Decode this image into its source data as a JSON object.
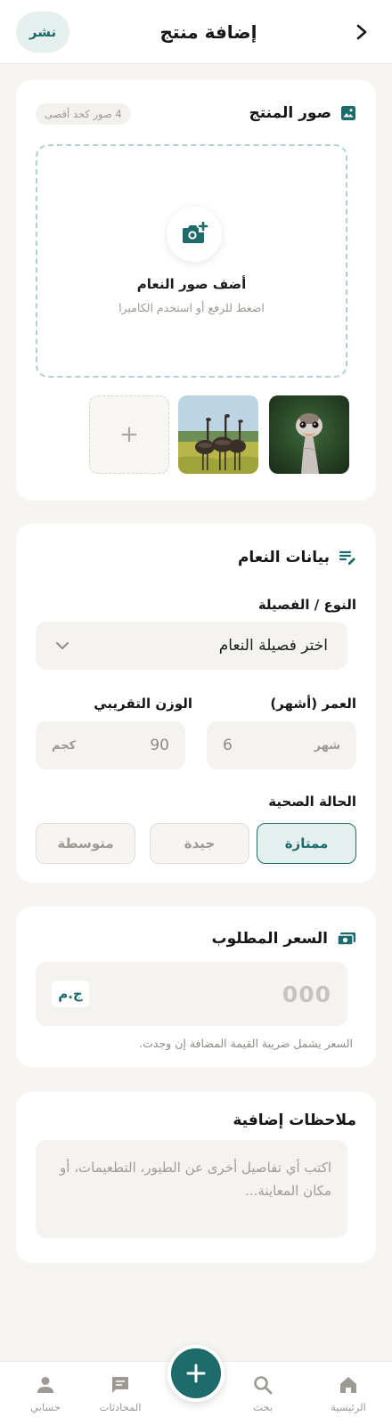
{
  "header": {
    "title": "إضافة منتج",
    "publish_label": "نشر"
  },
  "photos": {
    "title": "صور المنتج",
    "limit_badge": "4 صور كحد أقصى",
    "upload_title": "أضف صور النعام",
    "upload_subtitle": "اضغط للرفع أو استخدم الكاميرا",
    "add_more_symbol": "+"
  },
  "details": {
    "title": "بيانات النعام",
    "breed_label": "النوع / الفصيلة",
    "breed_placeholder": "اختر فصيلة النعام",
    "age_label": "العمر (أشهر)",
    "age_value": "6",
    "age_unit": "شهر",
    "weight_label": "الوزن التقريبي",
    "weight_value": "90",
    "weight_unit": "كجم",
    "health_label": "الحالة الصحية",
    "health_options": [
      "ممتازة",
      "جيدة",
      "متوسطة"
    ],
    "health_selected": "ممتازة"
  },
  "price": {
    "title": "السعر المطلوب",
    "value_placeholder": "000",
    "currency": "ج.م",
    "note": "السعر يشمل ضريبة القيمة المضافة إن وجدت."
  },
  "notes": {
    "title": "ملاحظات إضافية",
    "placeholder": "اكتب أي تفاصيل أخرى عن الطيور، التطعيمات، أو مكان المعاينة..."
  },
  "nav": {
    "home": "الرئيسية",
    "search": "بحث",
    "chats": "المحادثات",
    "account": "حسابي"
  },
  "colors": {
    "accent": "#1d6b6b",
    "accent_light": "#e5efee",
    "background": "#f6f5f2"
  }
}
